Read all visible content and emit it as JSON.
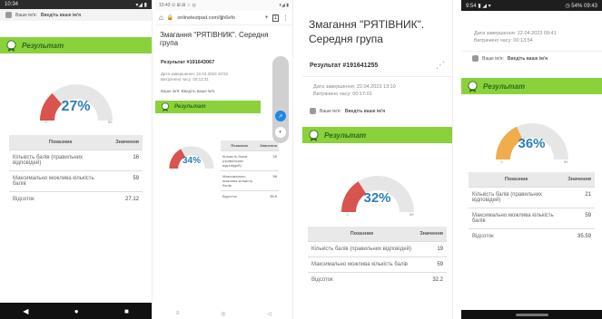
{
  "p1": {
    "time": "10:34",
    "status_right": "▾◢ ▮",
    "user_label": "Ваше ім'я: ",
    "user_name": "Введіть ваше ім'я",
    "result_title": "Результат",
    "percent": "27%",
    "fraction": 0.27,
    "scale_min": "0",
    "scale_max": "59",
    "th_indicator": "Показник",
    "th_value": "Значення",
    "rows": [
      {
        "label": "Кількість балів (правильних відповідей)",
        "value": "16"
      },
      {
        "label": "Максимально можлива кількість балів",
        "value": "59"
      },
      {
        "label": "Відсоток",
        "value": "27.12"
      }
    ]
  },
  "p2": {
    "status_left": "10:43 ⊙ ⊞ ⊞ ☆ ◎",
    "status_right": "▾◢ ▮",
    "url": "onlinetestpad.com/ljjh6efo",
    "title": "Змагання \"РЯТІВНИК\". Середня група",
    "result_num": "Результат #191643067",
    "date_label": "Дата завершення: 22.04.2023 10:52",
    "time_label": "Витрачено часу: 00:12:31",
    "user_label": "Ваше ім'я: Введіть ваше ім'я",
    "result_title": "Результат",
    "percent": "34%",
    "fraction": 0.34,
    "th_indicator": "Показник",
    "th_value": "Значення",
    "rows": [
      {
        "label": "Кількість балів (правильних відповідей)",
        "value": "20"
      },
      {
        "label": "Максимально можлива кількість балів",
        "value": "59"
      },
      {
        "label": "Відсоток",
        "value": "33.9"
      }
    ]
  },
  "p3": {
    "title": "Змагання \"РЯТІВНИК\". Середня група",
    "result_num": "Результат #191641255",
    "date_label": "Дата завершення:  22.04.2023 13:10",
    "time_label": "Витрачено часу:  00:17:01",
    "user_label": "Ваше ім'я: ",
    "user_name": "Введіть ваше ім'я",
    "result_title": "Результат",
    "percent": "32%",
    "fraction": 0.32,
    "scale_min": "0",
    "scale_max": "59",
    "th_indicator": "Показник",
    "th_value": "Значення",
    "rows": [
      {
        "label": "Кількість балів (правильних відповідей)",
        "value": "19"
      },
      {
        "label": "Максимально можлива кількість балів",
        "value": "59"
      },
      {
        "label": "Відсоток",
        "value": "32.2"
      }
    ]
  },
  "p4": {
    "status_left": "9:54 ▮ ◢ ▾",
    "status_right": "◷ 54% 09:43",
    "date_label": "Дата завершення:  22.04.2023 09:41",
    "time_label": "Витрачено часу:  00:13:54",
    "user_label": "Ваше ім'я: ",
    "user_name": "Введіть ваше ім'я",
    "result_title": "Результат",
    "percent": "36%",
    "fraction": 0.36,
    "scale_min": "0",
    "scale_max": "59",
    "th_indicator": "Показник",
    "th_value": "Значення",
    "rows": [
      {
        "label": "Кількість балів (правильних відповідей)",
        "value": "21"
      },
      {
        "label": "Максимально можлива кількість балів",
        "value": "59"
      },
      {
        "label": "Відсоток",
        "value": "35.59"
      }
    ]
  },
  "colors": {
    "green": "#8ad13b",
    "red": "#d9534f",
    "orange": "#f0ad4e",
    "blue": "#2c7fb8",
    "gauge_track": "#e6e6e6"
  }
}
